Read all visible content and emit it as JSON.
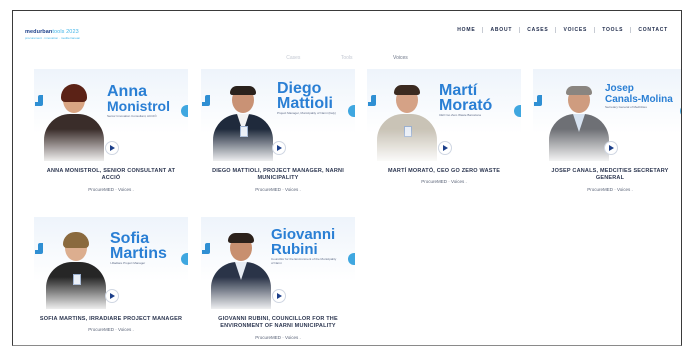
{
  "brand": {
    "name_primary": "medurban",
    "name_accent": "tools 2023",
    "tagline": "procurement · innovation · mediterranean"
  },
  "nav": {
    "items": [
      "HOME",
      "ABOUT",
      "CASES",
      "VOICES",
      "TOOLS",
      "CONTACT"
    ]
  },
  "filters": {
    "items": [
      "Cases",
      "Tools",
      "Voices"
    ],
    "active": "Voices"
  },
  "cards": [
    {
      "first": "Anna",
      "last": "Monistrol",
      "role": "Senior Innovation Consultant, ACCIÓ",
      "title": "ANNA MONISTROL, SENIOR CONSULTANT AT ACCIÓ",
      "tag": "ProcureMED",
      "category": "Voices"
    },
    {
      "first": "Diego",
      "last": "Mattioli",
      "role": "Project Manager, Municipality of Narni (Italy)",
      "title": "DIEGO MATTIOLI, PROJECT MANAGER, NARNI MUNICIPALITY",
      "tag": "ProcureMED",
      "category": "Voices"
    },
    {
      "first": "Martí",
      "last": "Morató",
      "role": "CEO Go Zero Waste Barcelona",
      "title": "MARTÍ MORATÓ, CEO GO ZERO WASTE",
      "tag": "ProcureMED",
      "category": "Voices"
    },
    {
      "first": "Josep",
      "last": "Canals-Molina",
      "role": "Secretary General of MedCities",
      "title": "JOSEP CANALS, MEDCITIES SECRETARY GENERAL",
      "tag": "ProcureMED",
      "category": "Voices"
    },
    {
      "first": "Sofia",
      "last": "Martins",
      "role": "I-Radiare Project Manager",
      "title": "SOFIA MARTINS, IRRADIARE PROJECT MANAGER",
      "tag": "ProcureMED",
      "category": "Voices"
    },
    {
      "first": "Giovanni",
      "last": "Rubini",
      "role": "Councillor for the Environment of the Municipality of Narni",
      "title": "GIOVANNI RUBINI, COUNCILLOR FOR THE ENVIRONMENT OF NARNI MUNICIPALITY",
      "tag": "ProcureMED",
      "category": "Voices"
    }
  ],
  "colors": {
    "accent": "#2a7fd4",
    "navy": "#1c3f8a",
    "light_blue": "#3fb4e8"
  }
}
